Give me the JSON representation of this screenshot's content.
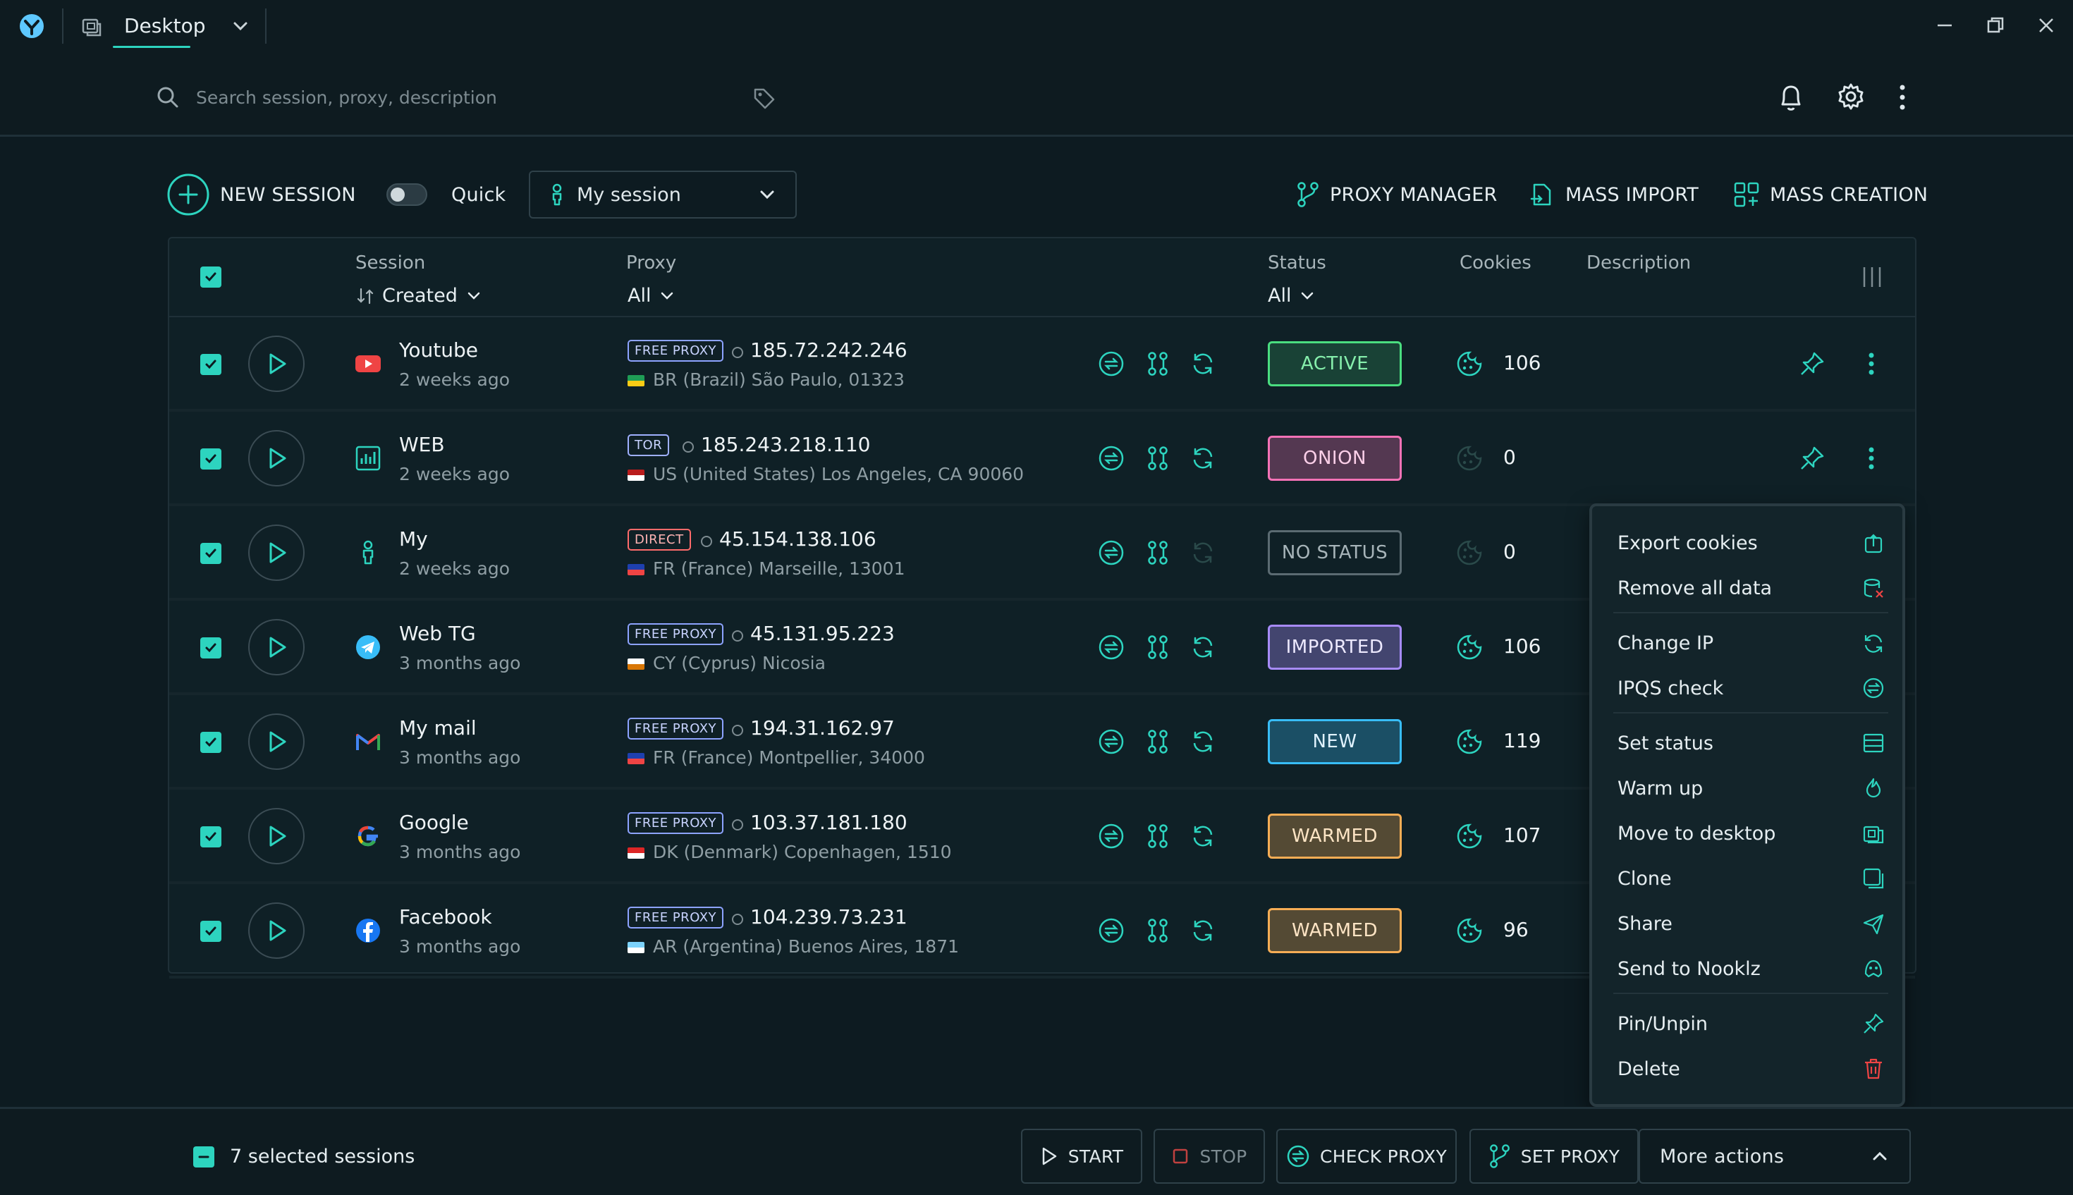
{
  "window": {
    "tab_label": "Desktop"
  },
  "search": {
    "placeholder": "Search session, proxy, description"
  },
  "toolbar": {
    "new_session": "NEW SESSION",
    "quick_label": "Quick",
    "session_select": "My session",
    "proxy_manager": "PROXY MANAGER",
    "mass_import": "MASS IMPORT",
    "mass_creation": "MASS CREATION"
  },
  "table": {
    "headers": {
      "session": "Session",
      "session_sort": "Created",
      "proxy": "Proxy",
      "proxy_filter": "All",
      "status": "Status",
      "status_filter": "All",
      "cookies": "Cookies",
      "description": "Description"
    },
    "rows": [
      {
        "name": "Youtube",
        "created": "2 weeks ago",
        "icon": "youtube-icon",
        "proxy_type": "FREE PROXY",
        "ip": "185.72.242.246",
        "location": "BR (Brazil) São Paulo, 01323",
        "status": "ACTIVE",
        "cookies": "106"
      },
      {
        "name": "WEB",
        "created": "2 weeks ago",
        "icon": "chart-icon",
        "proxy_type": "TOR",
        "ip": "185.243.218.110",
        "location": "US (United States) Los Angeles, CA 90060",
        "status": "ONION",
        "cookies": "0"
      },
      {
        "name": "My",
        "created": "2 weeks ago",
        "icon": "person-icon",
        "proxy_type": "DIRECT",
        "ip": "45.154.138.106",
        "location": "FR (France) Marseille, 13001",
        "status": "NO STATUS",
        "cookies": "0"
      },
      {
        "name": "Web TG",
        "created": "3 months ago",
        "icon": "telegram-icon",
        "proxy_type": "FREE PROXY",
        "ip": "45.131.95.223",
        "location": "CY (Cyprus) Nicosia",
        "status": "IMPORTED",
        "cookies": "106"
      },
      {
        "name": "My mail",
        "created": "3 months ago",
        "icon": "gmail-icon",
        "proxy_type": "FREE PROXY",
        "ip": "194.31.162.97",
        "location": "FR (France) Montpellier, 34000",
        "status": "NEW",
        "cookies": "119"
      },
      {
        "name": "Google",
        "created": "3 months ago",
        "icon": "google-icon",
        "proxy_type": "FREE PROXY",
        "ip": "103.37.181.180",
        "location": "DK (Denmark) Copenhagen, 1510",
        "status": "WARMED",
        "cookies": "107"
      },
      {
        "name": "Facebook",
        "created": "3 months ago",
        "icon": "facebook-icon",
        "proxy_type": "FREE PROXY",
        "ip": "104.239.73.231",
        "location": "AR (Argentina) Buenos Aires, 1871",
        "status": "WARMED",
        "cookies": "96"
      }
    ]
  },
  "context_menu": {
    "items": [
      {
        "label": "Export cookies"
      },
      {
        "label": "Remove all data"
      },
      {
        "label": "Change IP"
      },
      {
        "label": "IPQS check"
      },
      {
        "label": "Set status"
      },
      {
        "label": "Warm up"
      },
      {
        "label": "Move to desktop"
      },
      {
        "label": "Clone"
      },
      {
        "label": "Share"
      },
      {
        "label": "Send to Nooklz"
      },
      {
        "label": "Pin/Unpin"
      },
      {
        "label": "Delete"
      }
    ]
  },
  "bottom_bar": {
    "selected": "7 selected sessions",
    "start": "START",
    "stop": "STOP",
    "check_proxy": "CHECK PROXY",
    "set_proxy": "SET PROXY",
    "more_actions": "More actions"
  },
  "colors": {
    "accent": "#2dd4bf",
    "background": "#0d1b21",
    "status_active": "#4ade80",
    "status_onion": "#f472b6",
    "status_imported": "#a78bfa",
    "status_new": "#38bdf8",
    "status_warmed": "#f6ad55"
  }
}
